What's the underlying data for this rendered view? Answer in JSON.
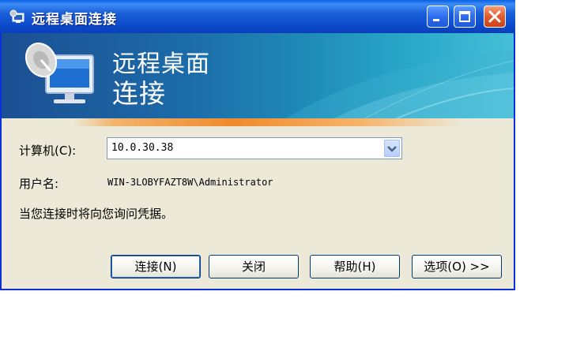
{
  "window": {
    "title": "远程桌面连接"
  },
  "banner": {
    "title_line1": "远程桌面",
    "title_line2": "连接"
  },
  "form": {
    "computer_label": "计算机(C):",
    "computer_value": "10.0.30.38",
    "user_label": "用户名:",
    "user_value": "WIN-3LOBYFAZT8W\\Administrator",
    "note": "当您连接时将向您询问凭据。"
  },
  "buttons": {
    "connect": "连接(N)",
    "close": "关闭",
    "help": "帮助(H)",
    "options": "选项(O) >>"
  },
  "icons": {
    "app": "remote-desktop-icon",
    "minimize": "minimize-icon",
    "maximize": "maximize-icon",
    "close": "close-icon",
    "dropdown": "chevron-down-icon"
  },
  "colors": {
    "titlebar": "#0b48c9",
    "banner": "#1c6aa8",
    "accent_stripe": "#f08a2b",
    "dialog_bg": "#ece9d8",
    "close_button": "#e35a2a"
  }
}
